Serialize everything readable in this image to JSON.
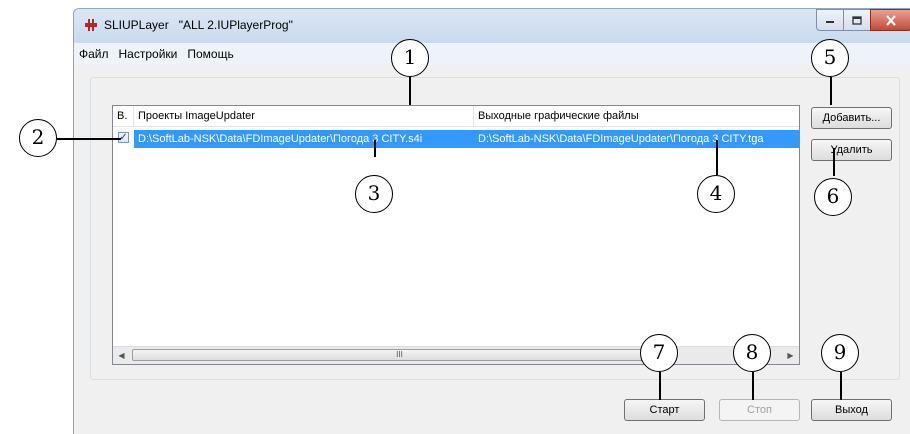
{
  "window": {
    "title": "SLIUPLayer   \"ALL 2.IUPlayerProg\""
  },
  "menu": [
    "Файл",
    "Настройки",
    "Помощь"
  ],
  "list": {
    "columns": [
      "В.",
      "Проекты ImageUpdater",
      "Выходные графические файлы"
    ],
    "rows": [
      {
        "checked": true,
        "project": "D:\\SoftLab-NSK\\Data\\FDImageUpdater\\Погода 3 CITY.s4i",
        "output": "D:\\SoftLab-NSK\\Data\\FDImageUpdater\\Погода 3 CITY.tga"
      }
    ],
    "scroll_thumb_glyph": "III"
  },
  "buttons": {
    "add": "Добавить...",
    "delete": "Удалить",
    "start": "Старт",
    "stop": "Стоп",
    "exit": "Выход"
  },
  "callouts": [
    "1",
    "2",
    "3",
    "4",
    "5",
    "6",
    "7",
    "8",
    "9"
  ],
  "colors": {
    "selection": "#3399ff",
    "close_button": "#c64a36"
  }
}
